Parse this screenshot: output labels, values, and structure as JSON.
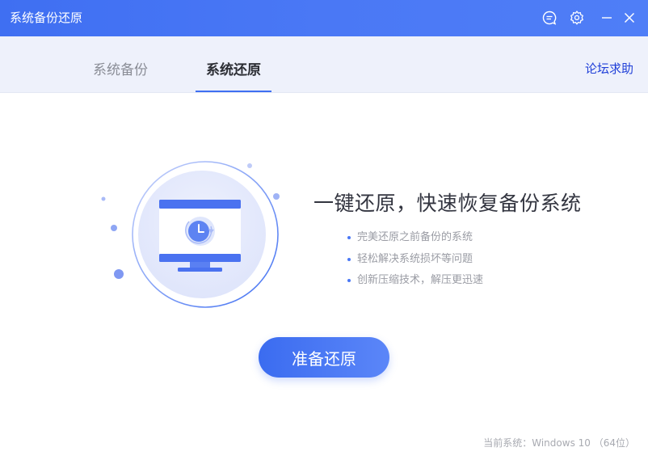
{
  "window": {
    "title": "系统备份还原",
    "controls": [
      "feedback-icon",
      "gear-icon",
      "minimize-icon",
      "close-icon"
    ]
  },
  "tabs": [
    {
      "label": "系统备份",
      "active": false
    },
    {
      "label": "系统还原",
      "active": true
    }
  ],
  "forum_link": "论坛求助",
  "main": {
    "headline": "一键还原，快速恢复备份系统",
    "features": [
      "完美还原之前备份的系统",
      "轻松解决系统损坏等问题",
      "创新压缩技术，解压更迅速"
    ],
    "primary_button": "准备还原"
  },
  "status": {
    "current_system": "当前系统：Windows 10 （64位）"
  },
  "colors": {
    "accent": "#3f6ff2",
    "tabbar_bg": "#eef1fb",
    "link": "#1f3fd8"
  }
}
